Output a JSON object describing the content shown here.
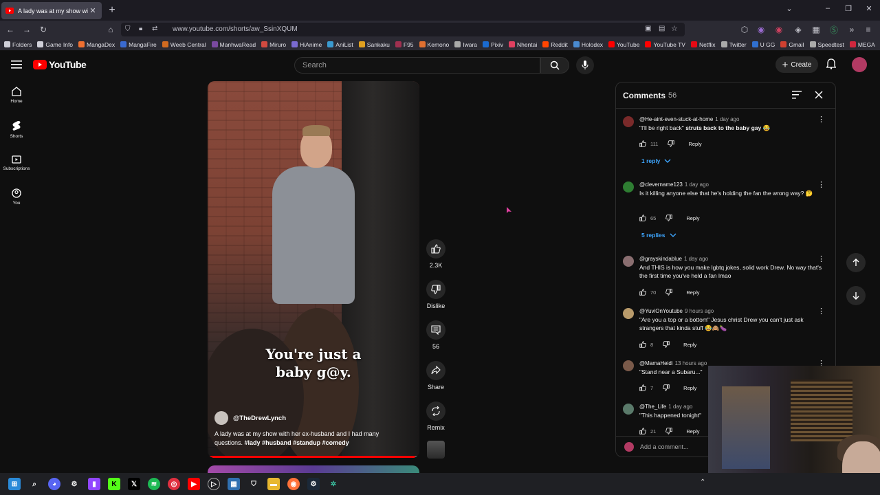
{
  "browser": {
    "tab_title": "A lady was at my show wit",
    "url": "www.youtube.com/shorts/aw_SsinXQUM",
    "bookmarks": [
      "Folders",
      "Game Info",
      "MangaDex",
      "MangaFire",
      "Weeb Central",
      "ManhwaRead",
      "Miruro",
      "HiAnime",
      "AniList",
      "Sankaku",
      "F95",
      "Kemono",
      "Iwara",
      "Pixiv",
      "Nhentai",
      "Reddit",
      "Holodex",
      "YouTube",
      "YouTube TV",
      "Netflix",
      "Twitter",
      "U GG",
      "Gmail",
      "Speedtest",
      "MEGA"
    ]
  },
  "youtube": {
    "logo_text": "YouTube",
    "search_placeholder": "Search",
    "create_label": "Create",
    "sidebar": [
      "Home",
      "Shorts",
      "Subscriptions",
      "You"
    ]
  },
  "video": {
    "caption_line1": "You're just a",
    "caption_line2": "baby g@y.",
    "channel": "@TheDrewLynch",
    "description": "A lady was at my show with her ex-husband and I had many questions.",
    "hashtags": "#lady #husband #standup #comedy",
    "progress": 0.98
  },
  "actions": {
    "likes": "2.3K",
    "dislike": "Dislike",
    "comments": "56",
    "share": "Share",
    "remix": "Remix"
  },
  "comments": {
    "title": "Comments",
    "count": "56",
    "add_placeholder": "Add a comment...",
    "items": [
      {
        "handle": "@He-aint-even-stuck-at-home",
        "time": "1 day ago",
        "text_a": "\"I'll be right back\" ",
        "text_b": "struts back to the baby gay 😂",
        "likes": "111",
        "reply": "Reply",
        "replies": "1 reply",
        "color": "#7a2a2a"
      },
      {
        "handle": "@clevername123",
        "time": "1 day ago",
        "text_a": "Is it killing anyone else that he's holding the fan the wrong way? 🤔",
        "text_b": "",
        "likes": "65",
        "reply": "Reply",
        "replies": "5 replies",
        "color": "#2e7d32"
      },
      {
        "handle": "@grayskindablue",
        "time": "1 day ago",
        "text_a": "And THIS is how you make lgbtq jokes, solid work Drew. No way that's the first time you've held a fan lmao",
        "text_b": "",
        "likes": "70",
        "reply": "Reply",
        "replies": "",
        "color": "#8a6e70"
      },
      {
        "handle": "@YuviOnYoutube",
        "time": "9 hours ago",
        "text_a": "\"Are you a top or a bottom\" Jesus christ Drew you can't just ask strangers that kinda stuff 😂🙈🍆",
        "text_b": "",
        "likes": "8",
        "reply": "Reply",
        "replies": "",
        "color": "#b89a6a"
      },
      {
        "handle": "@MamaHeidi",
        "time": "13 hours ago",
        "text_a": "\"Stand near a Subaru...\"",
        "text_b": "",
        "likes": "7",
        "reply": "Reply",
        "replies": "",
        "color": "#7a5a4a"
      },
      {
        "handle": "@The_Life",
        "time": "1 day ago",
        "text_a": "\"This happened tonight\"",
        "text_b": "",
        "likes": "21",
        "reply": "Reply",
        "replies": "",
        "color": "#5a7a6a"
      }
    ]
  }
}
